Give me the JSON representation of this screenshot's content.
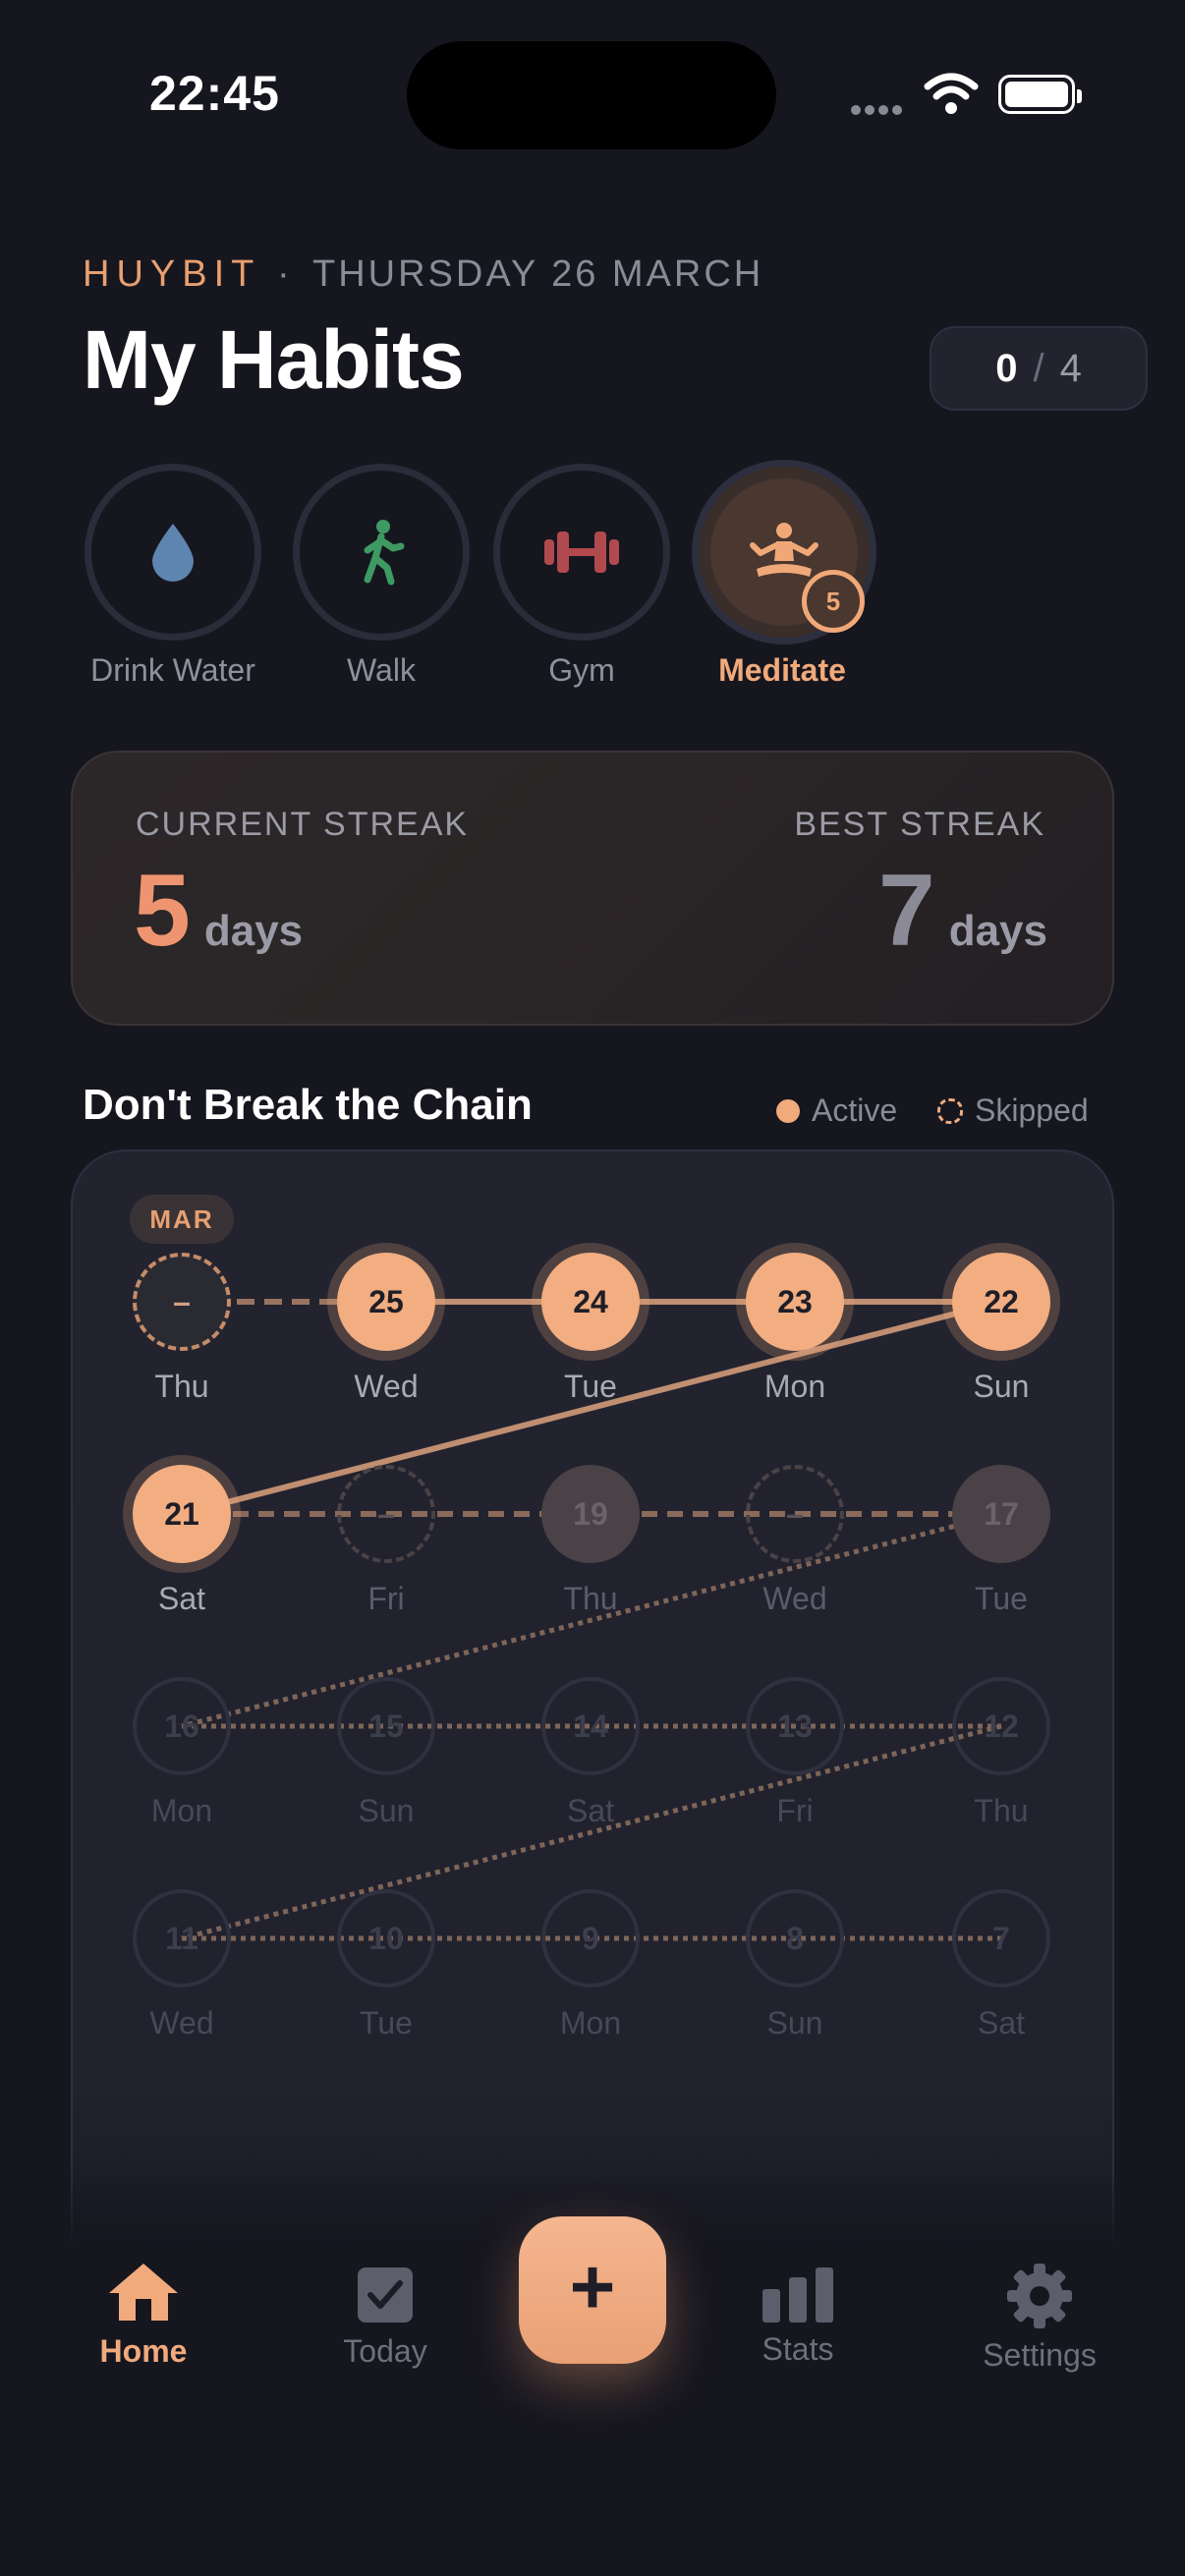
{
  "status": {
    "time": "22:45"
  },
  "header": {
    "brand": "HUYBIT",
    "separator": "·",
    "date": "THURSDAY 26 MARCH",
    "title": "My Habits",
    "done": "0",
    "slash": "/",
    "total": "4"
  },
  "habits": [
    {
      "label": "Drink Water",
      "icon": "water-drop-icon"
    },
    {
      "label": "Walk",
      "icon": "walking-person-icon"
    },
    {
      "label": "Gym",
      "icon": "dumbbell-icon"
    },
    {
      "label": "Meditate",
      "icon": "meditation-icon",
      "badge": "5",
      "selected": true
    }
  ],
  "streak": {
    "current_label": "CURRENT STREAK",
    "current_value": "5",
    "best_label": "BEST STREAK",
    "best_value": "7",
    "unit": "days"
  },
  "chain": {
    "title": "Don't Break the Chain",
    "legend_active": "Active",
    "legend_skipped": "Skipped",
    "month": "MAR",
    "rows": [
      [
        {
          "n": "–",
          "d": "Thu",
          "s": "skipped"
        },
        {
          "n": "25",
          "d": "Wed",
          "s": "active"
        },
        {
          "n": "24",
          "d": "Tue",
          "s": "active"
        },
        {
          "n": "23",
          "d": "Mon",
          "s": "active"
        },
        {
          "n": "22",
          "d": "Sun",
          "s": "active"
        }
      ],
      [
        {
          "n": "21",
          "d": "Sat",
          "s": "active"
        },
        {
          "n": "–",
          "d": "Fri",
          "s": "skipped-dim"
        },
        {
          "n": "19",
          "d": "Thu",
          "s": "missed"
        },
        {
          "n": "–",
          "d": "Wed",
          "s": "skipped-dim"
        },
        {
          "n": "17",
          "d": "Tue",
          "s": "missed"
        }
      ],
      [
        {
          "n": "16",
          "d": "Mon",
          "s": "future"
        },
        {
          "n": "15",
          "d": "Sun",
          "s": "future"
        },
        {
          "n": "14",
          "d": "Sat",
          "s": "future"
        },
        {
          "n": "13",
          "d": "Fri",
          "s": "future"
        },
        {
          "n": "12",
          "d": "Thu",
          "s": "future"
        }
      ],
      [
        {
          "n": "11",
          "d": "Wed",
          "s": "future"
        },
        {
          "n": "10",
          "d": "Tue",
          "s": "future"
        },
        {
          "n": "9",
          "d": "Mon",
          "s": "future"
        },
        {
          "n": "8",
          "d": "Sun",
          "s": "future"
        },
        {
          "n": "7",
          "d": "Sat",
          "s": "future"
        }
      ]
    ]
  },
  "nav": {
    "home": "Home",
    "today": "Today",
    "stats": "Stats",
    "settings": "Settings",
    "add": "+"
  },
  "colors": {
    "accent": "#f0aa7c",
    "background": "#16161f",
    "card": "#22232f"
  }
}
